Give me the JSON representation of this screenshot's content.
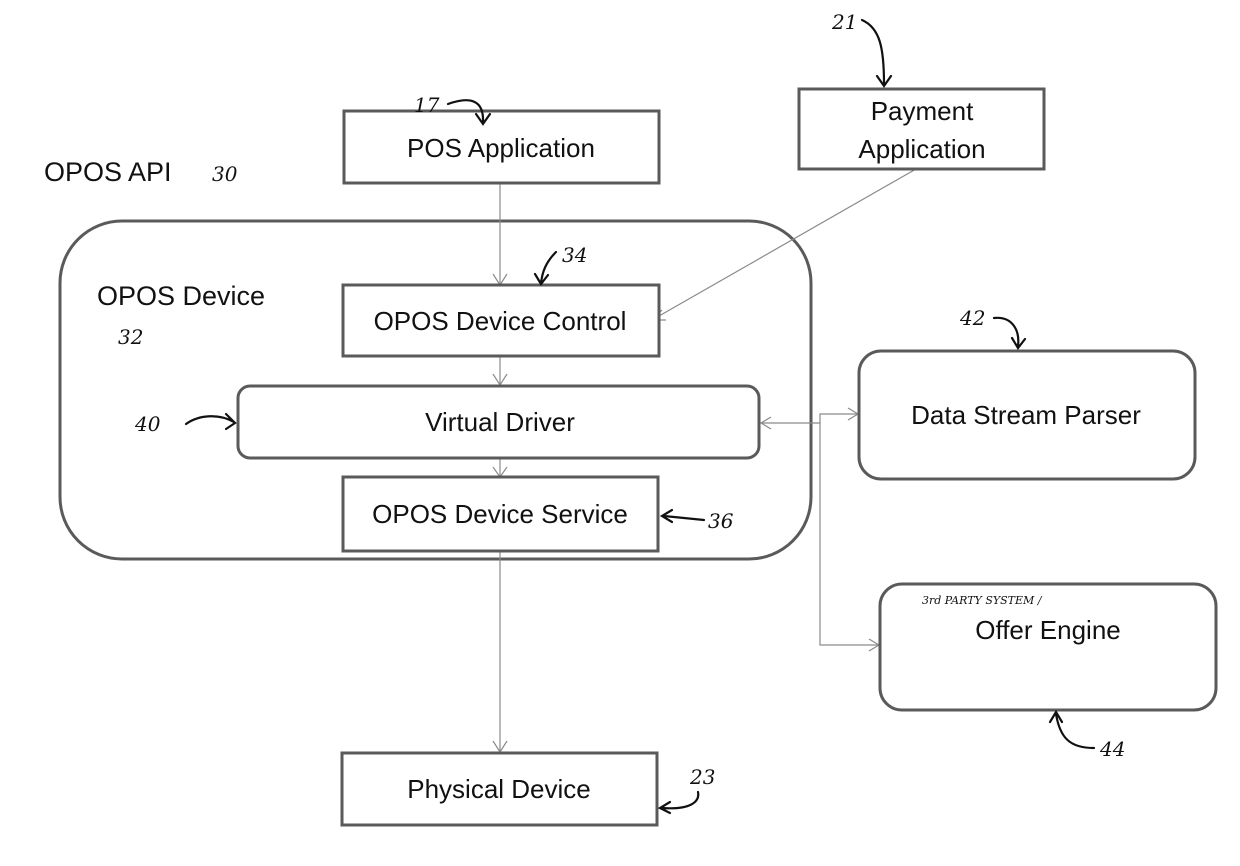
{
  "diagram": {
    "title_label": "OPOS API",
    "title_ref": "30",
    "container": {
      "label": "OPOS Device",
      "ref": "32"
    },
    "nodes": {
      "pos_application": {
        "label": "POS Application",
        "ref": "17"
      },
      "payment_application": {
        "label_line1": "Payment",
        "label_line2": "Application",
        "ref": "21"
      },
      "device_control": {
        "label": "OPOS Device Control",
        "ref": "34"
      },
      "virtual_driver": {
        "label": "Virtual Driver",
        "ref": "40"
      },
      "device_service": {
        "label": "OPOS Device Service",
        "ref": "36"
      },
      "data_stream_parser": {
        "label": "Data Stream Parser",
        "ref": "42"
      },
      "offer_engine": {
        "label": "Offer Engine",
        "annotation": "3rd PARTY SYSTEM /",
        "ref": "44"
      },
      "physical_device": {
        "label": "Physical Device",
        "ref": "23"
      }
    },
    "edges": [
      {
        "from": "POS Application",
        "to": "OPOS Device Control"
      },
      {
        "from": "Payment Application",
        "to": "OPOS Device Control"
      },
      {
        "from": "OPOS Device Control",
        "to": "Virtual Driver"
      },
      {
        "from": "Virtual Driver",
        "to": "OPOS Device Service"
      },
      {
        "from": "OPOS Device Service",
        "to": "Physical Device"
      },
      {
        "from": "Virtual Driver",
        "to": "Data Stream Parser",
        "bidirectional": true
      },
      {
        "from": "Virtual Driver",
        "to": "Offer Engine",
        "bidirectional": true
      }
    ]
  }
}
